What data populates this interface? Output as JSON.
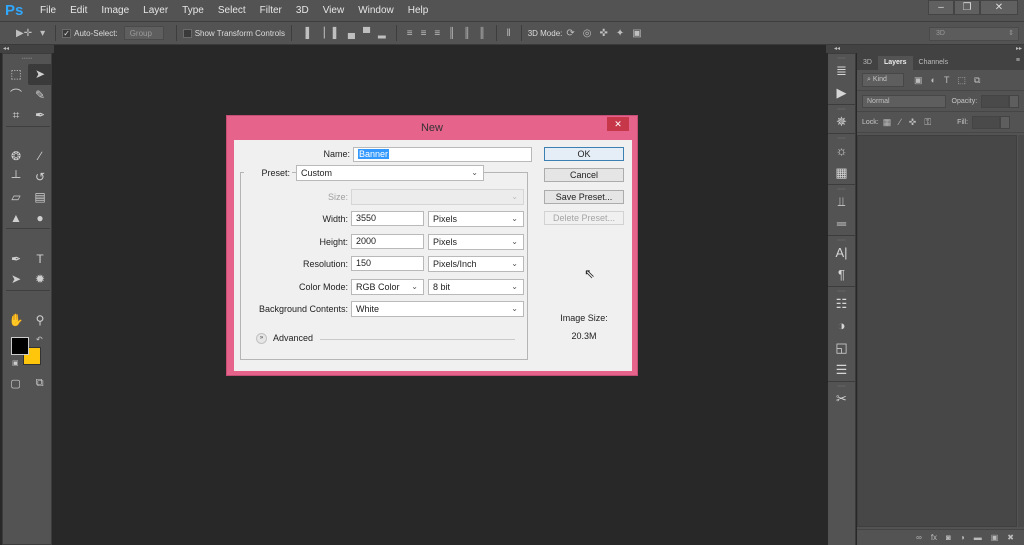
{
  "app": {
    "logo": "Ps"
  },
  "menu": [
    "File",
    "Edit",
    "Image",
    "Layer",
    "Type",
    "Select",
    "Filter",
    "3D",
    "View",
    "Window",
    "Help"
  ],
  "window_controls": {
    "minimize": "–",
    "restore": "❐",
    "close": "✕"
  },
  "options_bar": {
    "tool_icon": "▶✛",
    "auto_select_label": "Auto-Select:",
    "auto_select_checked": "✓",
    "auto_select_target": "Group",
    "show_transform_label": "Show Transform Controls",
    "align_icons": [
      "▐",
      "▕",
      "▌",
      "▄",
      "▀",
      "▂"
    ],
    "distribute_icons": [
      "≡",
      "≡",
      "≡",
      "║",
      "║",
      "║",
      "‖"
    ],
    "mode_3d_label": "3D Mode:",
    "mode_3d_icons": [
      "⟳",
      "◎",
      "✜",
      "✦",
      "▣"
    ],
    "workspace": "3D"
  },
  "toolbox": {
    "collapse": "◂◂",
    "grip": "••••••",
    "tools": [
      {
        "name": "rectangular-marquee-tool",
        "glyph": "⬚"
      },
      {
        "name": "move-tool",
        "glyph": "➤",
        "active": true
      },
      {
        "name": "lasso-tool",
        "glyph": "⌒"
      },
      {
        "name": "quick-selection-tool",
        "glyph": "✎"
      },
      {
        "name": "crop-tool",
        "glyph": "⌗"
      },
      {
        "name": "eyedropper-tool",
        "glyph": "✒"
      },
      {
        "sep": true
      },
      {
        "name": "spot-healing-tool",
        "glyph": "❂"
      },
      {
        "name": "brush-tool",
        "glyph": "∕"
      },
      {
        "name": "clone-stamp-tool",
        "glyph": "┴"
      },
      {
        "name": "history-brush-tool",
        "glyph": "↺"
      },
      {
        "name": "eraser-tool",
        "glyph": "▱"
      },
      {
        "name": "gradient-tool",
        "glyph": "▤"
      },
      {
        "name": "blur-tool",
        "glyph": "▲"
      },
      {
        "name": "dodge-tool",
        "glyph": "●"
      },
      {
        "sep": true
      },
      {
        "name": "pen-tool",
        "glyph": "✒"
      },
      {
        "name": "type-tool",
        "glyph": "T"
      },
      {
        "name": "path-selection-tool",
        "glyph": "➤"
      },
      {
        "name": "custom-shape-tool",
        "glyph": "✹"
      },
      {
        "sep": true
      },
      {
        "name": "hand-tool",
        "glyph": "✋"
      },
      {
        "name": "zoom-tool",
        "glyph": "⚲"
      }
    ],
    "colors": {
      "foreground": "#000000",
      "background": "#ffc60b"
    },
    "swap_icon": "↶",
    "default_icon": "▣",
    "quick_mask_icon": "▢",
    "screen_mode_icon": "⧉"
  },
  "right_dock": {
    "collapse_left": "◂◂",
    "collapse_right": "▸▸",
    "grip": "••••••",
    "groups": [
      [
        {
          "name": "history-icon",
          "glyph": "≣"
        },
        {
          "name": "actions-play-icon",
          "glyph": "▶"
        }
      ],
      [
        {
          "name": "3d-light-icon",
          "glyph": "✵"
        }
      ],
      [
        {
          "name": "color-palette-icon",
          "glyph": "☼"
        },
        {
          "name": "swatches-icon",
          "glyph": "▦"
        }
      ],
      [
        {
          "name": "brush-presets-icon",
          "glyph": "⫫"
        },
        {
          "name": "tool-presets-icon",
          "glyph": "═"
        }
      ],
      [
        {
          "name": "character-icon",
          "glyph": "A|"
        },
        {
          "name": "paragraph-icon",
          "glyph": "¶"
        }
      ],
      [
        {
          "name": "adjustments-icon",
          "glyph": "☷"
        },
        {
          "name": "styles-icon",
          "glyph": "◑"
        },
        {
          "name": "navigator-icon",
          "glyph": "◱"
        },
        {
          "name": "info-icon",
          "glyph": "☰"
        }
      ],
      [
        {
          "name": "tools-icon",
          "glyph": "✂"
        }
      ]
    ]
  },
  "layers_panel": {
    "tabs": [
      {
        "label": "3D",
        "active": false
      },
      {
        "label": "Layers",
        "active": true
      },
      {
        "label": "Channels",
        "active": false
      }
    ],
    "menu_icon": "≡",
    "filter_kind": "⌕ Kind",
    "filter_icons": [
      "▣",
      "◐",
      "T",
      "⬚",
      "⧉"
    ],
    "blend_mode": "Normal",
    "opacity_label": "Opacity:",
    "opacity_value": "",
    "lock_label": "Lock:",
    "lock_icons": [
      "▦",
      "∕",
      "✜",
      "⚿"
    ],
    "fill_label": "Fill:",
    "fill_value": "",
    "footer_icons": [
      {
        "name": "link-layers-icon",
        "glyph": "∞"
      },
      {
        "name": "fx-icon",
        "glyph": "fx"
      },
      {
        "name": "add-mask-icon",
        "glyph": "◙"
      },
      {
        "name": "adjustment-layer-icon",
        "glyph": "◑"
      },
      {
        "name": "new-group-icon",
        "glyph": "▬"
      },
      {
        "name": "new-layer-icon",
        "glyph": "▣"
      },
      {
        "name": "delete-layer-icon",
        "glyph": "✖"
      }
    ]
  },
  "dialog": {
    "title": "New",
    "close": "✕",
    "name_label": "Name:",
    "name_value": "Banner",
    "preset_label": "Preset:",
    "preset_value": "Custom",
    "size_label": "Size:",
    "size_value": "",
    "width_label": "Width:",
    "width_value": "3550",
    "width_unit": "Pixels",
    "height_label": "Height:",
    "height_value": "2000",
    "height_unit": "Pixels",
    "resolution_label": "Resolution:",
    "resolution_value": "150",
    "resolution_unit": "Pixels/Inch",
    "color_mode_label": "Color Mode:",
    "color_mode_value": "RGB Color",
    "bit_depth_value": "8 bit",
    "background_label": "Background Contents:",
    "background_value": "White",
    "advanced_label": "Advanced",
    "advanced_icon": "»",
    "ok_label": "OK",
    "cancel_label": "Cancel",
    "save_preset_label": "Save Preset...",
    "delete_preset_label": "Delete Preset...",
    "image_size_label": "Image Size:",
    "image_size_value": "20.3M",
    "chevron": "⌵",
    "cursor": "⇖"
  }
}
